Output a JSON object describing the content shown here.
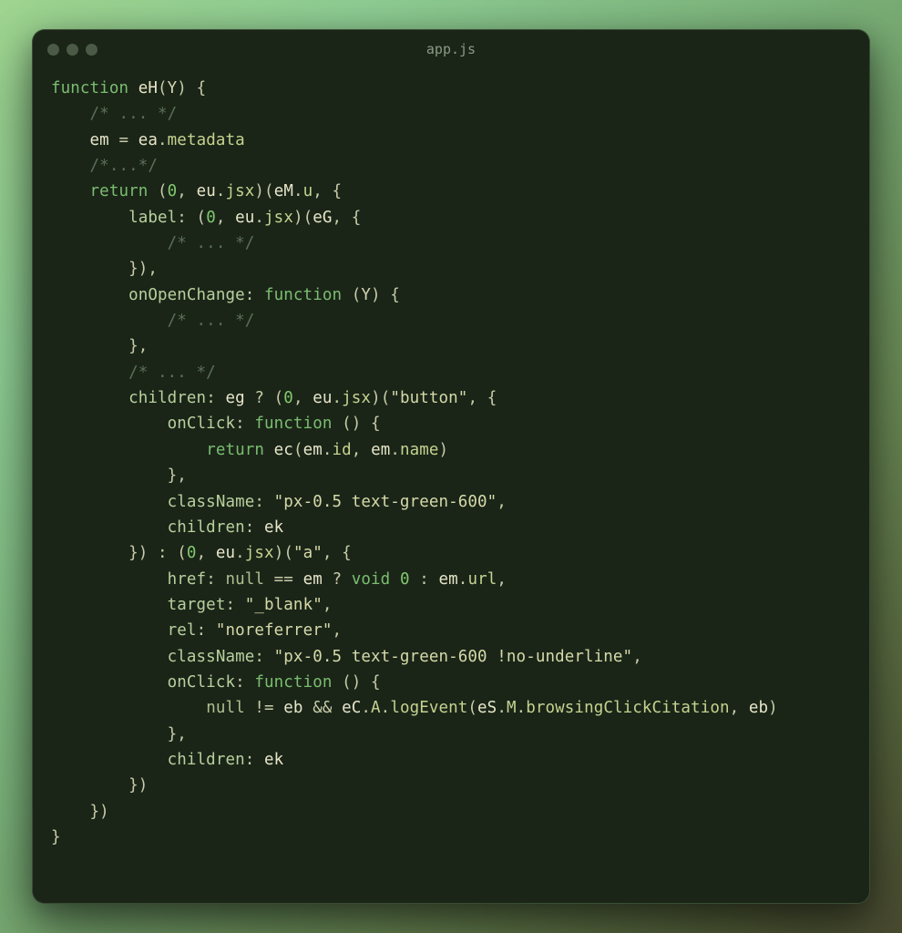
{
  "window": {
    "title": "app.js"
  },
  "code": {
    "l01_function": "function",
    "l01_name": "eH",
    "l01_paren_open": "(",
    "l01_param": "Y",
    "l01_paren_close": ")",
    "l01_brace": "{",
    "l02_cmt": "/* ... */",
    "l03_lhs": "em",
    "l03_eq": " = ",
    "l03_rhs_obj": "ea",
    "l03_dot": ".",
    "l03_rhs_prop": "metadata",
    "l04_cmt": "/*...*/",
    "l05_return": "return",
    "l05_open": " (",
    "l05_zero": "0",
    "l05_comma": ", ",
    "l05_eu": "eu",
    "l05_dot": ".",
    "l05_jsx": "jsx",
    "l05_close_call": ")(",
    "l05_eM": "eM",
    "l05_dot2": ".",
    "l05_u": "u",
    "l05_tail": ", {",
    "l06_key": "label",
    "l06_colon": ": (",
    "l06_zero": "0",
    "l06_comma": ", ",
    "l06_eu": "eu",
    "l06_dot": ".",
    "l06_jsx": "jsx",
    "l06_close": ")(",
    "l06_eG": "eG",
    "l06_tail": ", {",
    "l07_cmt": "/* ... */",
    "l08_close": "}),",
    "l09_key": "onOpenChange",
    "l09_colon": ": ",
    "l09_function": "function",
    "l09_paren": " (",
    "l09_param": "Y",
    "l09_tail": ") {",
    "l10_cmt": "/* ... */",
    "l11_close": "},",
    "l12_cmt": "/* ... */",
    "l13_key": "children",
    "l13_colon": ": ",
    "l13_eg": "eg",
    "l13_q": " ? (",
    "l13_zero": "0",
    "l13_comma": ", ",
    "l13_eu": "eu",
    "l13_dot": ".",
    "l13_jsx": "jsx",
    "l13_close": ")(",
    "l13_str": "\"button\"",
    "l13_tail": ", {",
    "l14_key": "onClick",
    "l14_colon": ": ",
    "l14_function": "function",
    "l14_tail": " () {",
    "l15_return": "return",
    "l15_sp": " ",
    "l15_ec": "ec",
    "l15_open": "(",
    "l15_em1": "em",
    "l15_dot1": ".",
    "l15_id": "id",
    "l15_comma": ", ",
    "l15_em2": "em",
    "l15_dot2": ".",
    "l15_name": "name",
    "l15_close": ")",
    "l16_close": "},",
    "l17_key": "className",
    "l17_colon": ": ",
    "l17_str": "\"px-0.5 text-green-600\"",
    "l17_comma": ",",
    "l18_key": "children",
    "l18_colon": ": ",
    "l18_ek": "ek",
    "l19_head": "}) : (",
    "l19_zero": "0",
    "l19_comma": ", ",
    "l19_eu": "eu",
    "l19_dot": ".",
    "l19_jsx": "jsx",
    "l19_close": ")(",
    "l19_str": "\"a\"",
    "l19_tail": ", {",
    "l20_key": "href",
    "l20_colon": ": ",
    "l20_null": "null",
    "l20_eq": " == ",
    "l20_em": "em",
    "l20_q": " ? ",
    "l20_void": "void",
    "l20_sp": " ",
    "l20_zero": "0",
    "l20_colon2": " : ",
    "l20_em2": "em",
    "l20_dot": ".",
    "l20_url": "url",
    "l20_comma": ",",
    "l21_key": "target",
    "l21_colon": ": ",
    "l21_str": "\"_blank\"",
    "l21_comma": ",",
    "l22_key": "rel",
    "l22_colon": ": ",
    "l22_str": "\"noreferrer\"",
    "l22_comma": ",",
    "l23_key": "className",
    "l23_colon": ": ",
    "l23_str": "\"px-0.5 text-green-600 !no-underline\"",
    "l23_comma": ",",
    "l24_key": "onClick",
    "l24_colon": ": ",
    "l24_function": "function",
    "l24_tail": " () {",
    "l25_null": "null",
    "l25_neq": " != ",
    "l25_eb": "eb",
    "l25_and": " && ",
    "l25_eC": "eC",
    "l25_dot1": ".",
    "l25_A": "A",
    "l25_dot2": ".",
    "l25_log": "logEvent",
    "l25_open": "(",
    "l25_eS": "eS",
    "l25_dot3": ".",
    "l25_M": "M",
    "l25_dot4": ".",
    "l25_bcc": "browsingClickCitation",
    "l25_comma": ", ",
    "l25_eb2": "eb",
    "l25_close": ")",
    "l26_close": "},",
    "l27_key": "children",
    "l27_colon": ": ",
    "l27_ek": "ek",
    "l28_close": "})",
    "l29_close": "})",
    "l30_close": "}"
  }
}
